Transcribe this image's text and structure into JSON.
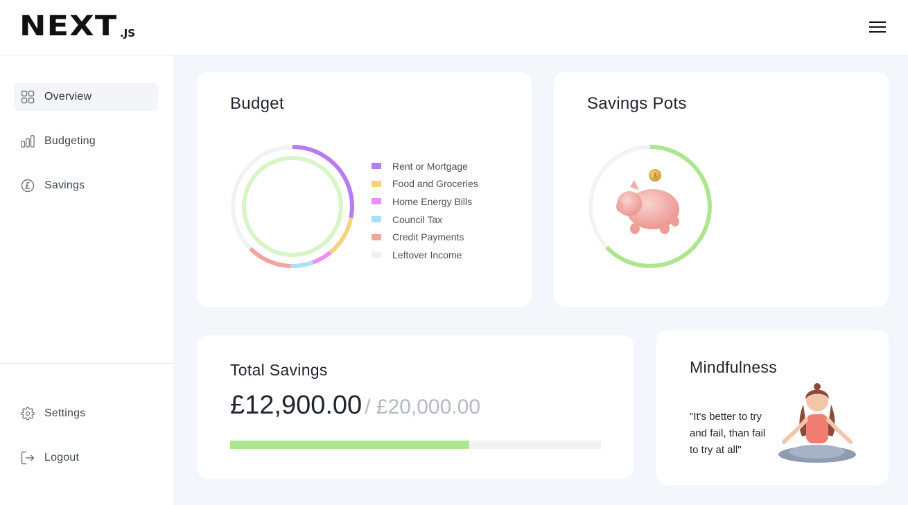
{
  "header": {
    "logo_main": "NEXT",
    "logo_sub": ".JS",
    "menu_icon": "hamburger-menu-icon"
  },
  "sidebar": {
    "items": [
      {
        "label": "Overview",
        "icon": "grid-icon",
        "active": true
      },
      {
        "label": "Budgeting",
        "icon": "bar-chart-icon",
        "active": false
      },
      {
        "label": "Savings",
        "icon": "pound-coin-icon",
        "active": false
      }
    ],
    "bottom_items": [
      {
        "label": "Settings",
        "icon": "gear-icon"
      },
      {
        "label": "Logout",
        "icon": "logout-icon"
      }
    ]
  },
  "budget": {
    "title": "Budget",
    "legend": [
      {
        "label": "Rent or Mortgage",
        "color": "#b97bf1"
      },
      {
        "label": "Food and Groceries",
        "color": "#f8d27e"
      },
      {
        "label": "Home Energy Bills",
        "color": "#ef8ef0"
      },
      {
        "label": "Council Tax",
        "color": "#a9e0f5"
      },
      {
        "label": "Credit Payments",
        "color": "#f4a49c"
      },
      {
        "label": "Leftover Income",
        "color": "#f0f0f0"
      }
    ],
    "inner_ring_color": "#d7f5c6"
  },
  "savings_pots": {
    "title": "Savings Pots",
    "progress_percent": 63,
    "ring_color": "#aee58f",
    "track_color": "#f3f3f3",
    "illustration": "piggy-bank-icon"
  },
  "total_savings": {
    "title": "Total Savings",
    "amount": "£12,900.00",
    "target": "/ £20,000.00",
    "progress_percent": 64.5
  },
  "mindfulness": {
    "title": "Mindfulness",
    "quote": "\"It's better to try and fail, than fail to try at all\"",
    "illustration": "meditating-woman-icon"
  }
}
